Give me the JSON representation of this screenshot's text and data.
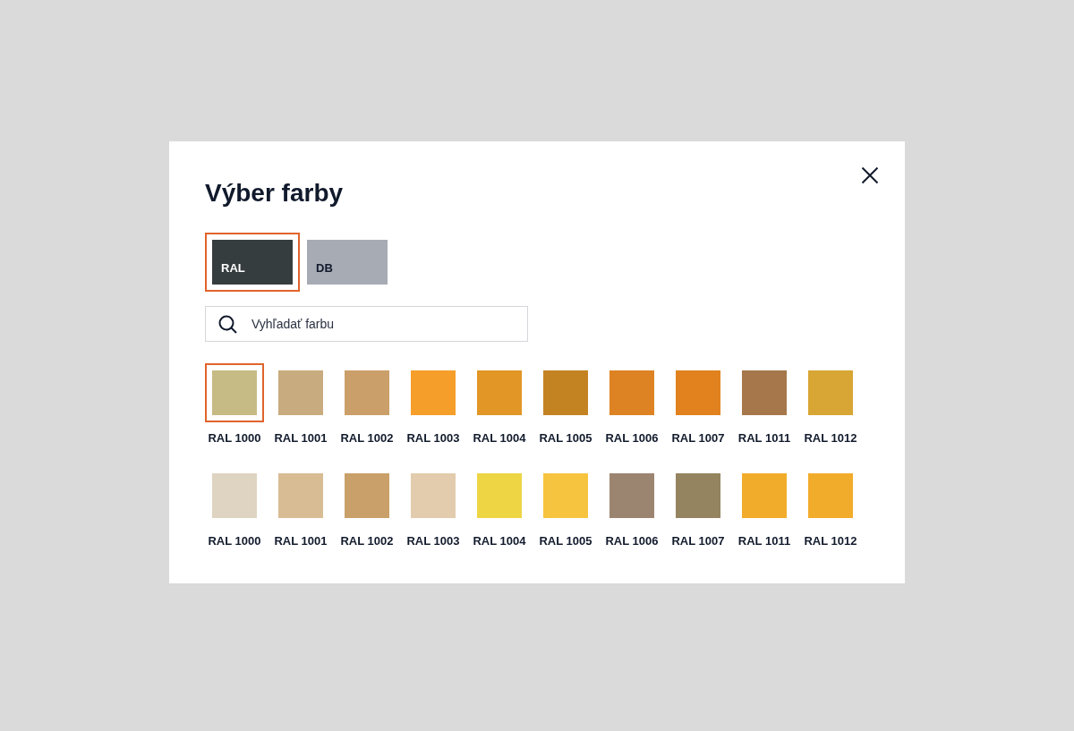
{
  "dialog": {
    "title": "Výber farby"
  },
  "palettes": [
    {
      "label": "RAL",
      "color": "#363d3f",
      "selected": true
    },
    {
      "label": "DB",
      "color": "#a6abb4",
      "selected": false
    }
  ],
  "search": {
    "placeholder": "Vyhľadať farbu"
  },
  "swatch_rows": [
    {
      "swatches": [
        {
          "label": "RAL 1000",
          "color": "#c6bb84",
          "selected": true
        },
        {
          "label": "RAL 1001",
          "color": "#c8ab7e",
          "selected": false
        },
        {
          "label": "RAL 1002",
          "color": "#cb9f69",
          "selected": false
        },
        {
          "label": "RAL 1003",
          "color": "#f59e2a",
          "selected": false
        },
        {
          "label": "RAL 1004",
          "color": "#e19626",
          "selected": false
        },
        {
          "label": "RAL 1005",
          "color": "#c48322",
          "selected": false
        },
        {
          "label": "RAL 1006",
          "color": "#dd8323",
          "selected": false
        },
        {
          "label": "RAL 1007",
          "color": "#e1821f",
          "selected": false
        },
        {
          "label": "RAL 1011",
          "color": "#a5774a",
          "selected": false
        },
        {
          "label": "RAL 1012",
          "color": "#d8a634",
          "selected": false
        }
      ]
    },
    {
      "swatches": [
        {
          "label": "RAL 1000",
          "color": "#ded4c1",
          "selected": false
        },
        {
          "label": "RAL 1001",
          "color": "#d8bc94",
          "selected": false
        },
        {
          "label": "RAL 1002",
          "color": "#c9a069",
          "selected": false
        },
        {
          "label": "RAL 1003",
          "color": "#e2ccad",
          "selected": false
        },
        {
          "label": "RAL 1004",
          "color": "#edd544",
          "selected": false
        },
        {
          "label": "RAL 1005",
          "color": "#f7c440",
          "selected": false
        },
        {
          "label": "RAL 1006",
          "color": "#9c8570",
          "selected": false
        },
        {
          "label": "RAL 1007",
          "color": "#958460",
          "selected": false
        },
        {
          "label": "RAL 1011",
          "color": "#f2ac2b",
          "selected": false
        },
        {
          "label": "RAL 1012",
          "color": "#f2ac2b",
          "selected": false
        }
      ]
    }
  ]
}
